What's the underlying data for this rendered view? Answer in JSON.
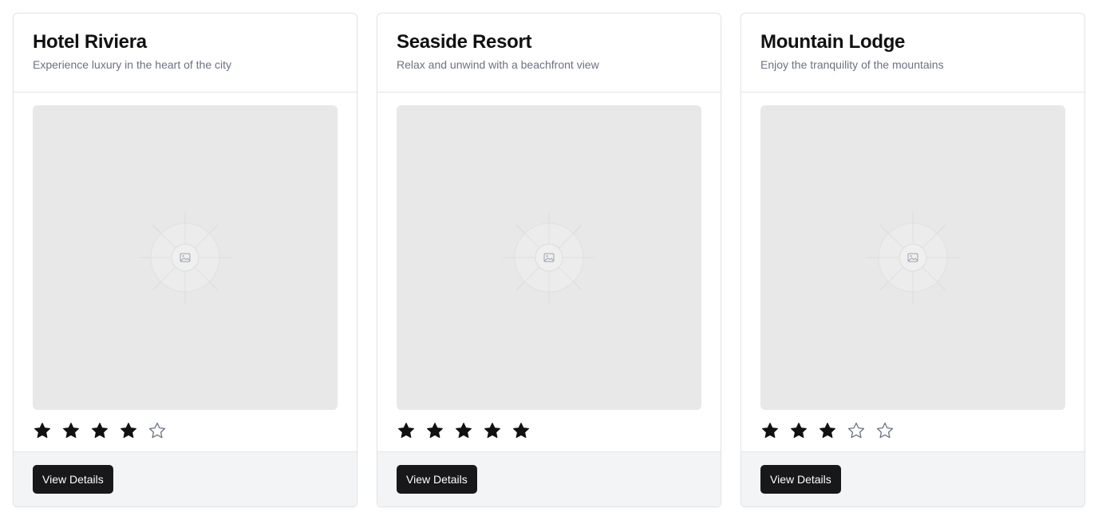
{
  "cards": [
    {
      "title": "Hotel Riviera",
      "subtitle": "Experience luxury in the heart of the city",
      "rating": 4,
      "max_rating": 5,
      "button_label": "View Details"
    },
    {
      "title": "Seaside Resort",
      "subtitle": "Relax and unwind with a beachfront view",
      "rating": 5,
      "max_rating": 5,
      "button_label": "View Details"
    },
    {
      "title": "Mountain Lodge",
      "subtitle": "Enjoy the tranquility of the mountains",
      "rating": 3,
      "max_rating": 5,
      "button_label": "View Details"
    }
  ],
  "colors": {
    "star_filled": "#111111",
    "star_empty_stroke": "#6b7280",
    "button_bg": "#18181b",
    "footer_bg": "#f3f4f6",
    "placeholder_bg": "#e8e8e8"
  },
  "icons": {
    "image_placeholder": "image-icon",
    "star": "star-icon"
  }
}
